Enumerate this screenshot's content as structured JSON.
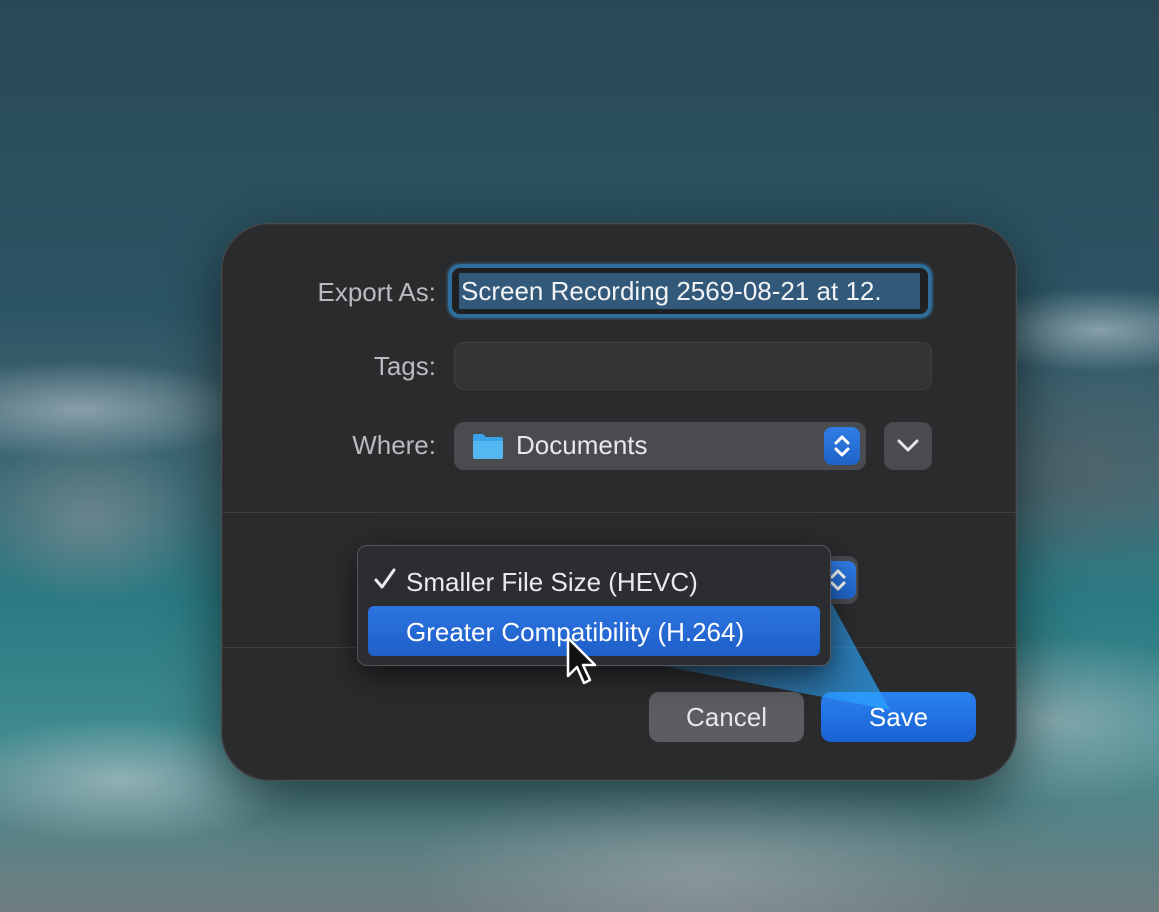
{
  "dialog": {
    "export_label": "Export As:",
    "export_value": "Screen Recording 2569-08-21 at 12.",
    "tags_label": "Tags:",
    "tags_value": "",
    "where_label": "Where:",
    "where_value": "Documents",
    "cancel_label": "Cancel",
    "save_label": "Save"
  },
  "format_menu": {
    "items": [
      {
        "label": "Smaller File Size (HEVC)",
        "checked": true
      },
      {
        "label": "Greater Compatibility (H.264)",
        "highlighted": true
      }
    ]
  },
  "colors": {
    "accent": "#1f6bd6",
    "dialog_bg": "#2a2b2d",
    "selection": "#33597a"
  },
  "icons": [
    "folder-icon",
    "stepper-icon",
    "chevron-down-icon",
    "checkmark-icon",
    "pointer-cursor-icon"
  ]
}
